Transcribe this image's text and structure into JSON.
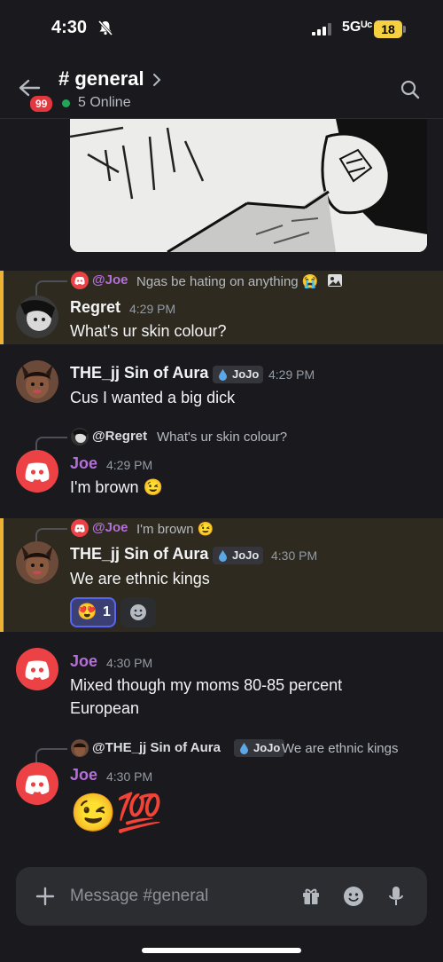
{
  "status_bar": {
    "time": "4:30",
    "network": "5Gᵁᶜ",
    "battery": "18"
  },
  "header": {
    "channel_title": "# general",
    "online_text": "5 Online",
    "unread_badge": "99"
  },
  "messages": [
    {
      "reply": {
        "name": "@Joe",
        "text": "Ngas be hating on anything 😭"
      },
      "author": "Regret",
      "time": "4:29 PM",
      "text": "What's ur skin colour?",
      "highlighted": true
    },
    {
      "author": "THE_jj Sin of Aura",
      "tag": "JoJo",
      "time": "4:29 PM",
      "text": "Cus I wanted a big dick"
    },
    {
      "reply": {
        "name": "@Regret",
        "text": "What's ur skin colour?"
      },
      "author": "Joe",
      "time": "4:29 PM",
      "text": "I'm brown 😉"
    },
    {
      "reply": {
        "name": "@Joe",
        "text": "I'm brown 😉"
      },
      "author": "THE_jj Sin of Aura",
      "tag": "JoJo",
      "time": "4:30 PM",
      "text": "We are ethnic kings",
      "highlighted": true,
      "reaction": {
        "emoji": "😍",
        "count": "1"
      }
    },
    {
      "author": "Joe",
      "time": "4:30 PM",
      "text_line1": "Mixed though my moms 80-85 percent",
      "text_line2": "European"
    },
    {
      "reply": {
        "name": "@THE_jj Sin of Aura",
        "tag": "JoJo",
        "text": "We are ethnic kings"
      },
      "author": "Joe",
      "time": "4:30 PM",
      "text": "😉💯"
    }
  ],
  "composer": {
    "placeholder": "Message #general"
  },
  "colors": {
    "background": "#1a1a1e",
    "highlight_border": "#f0b232",
    "joe_name": "#b46fd9",
    "discord_red": "#ed4245",
    "online_green": "#23a559"
  }
}
